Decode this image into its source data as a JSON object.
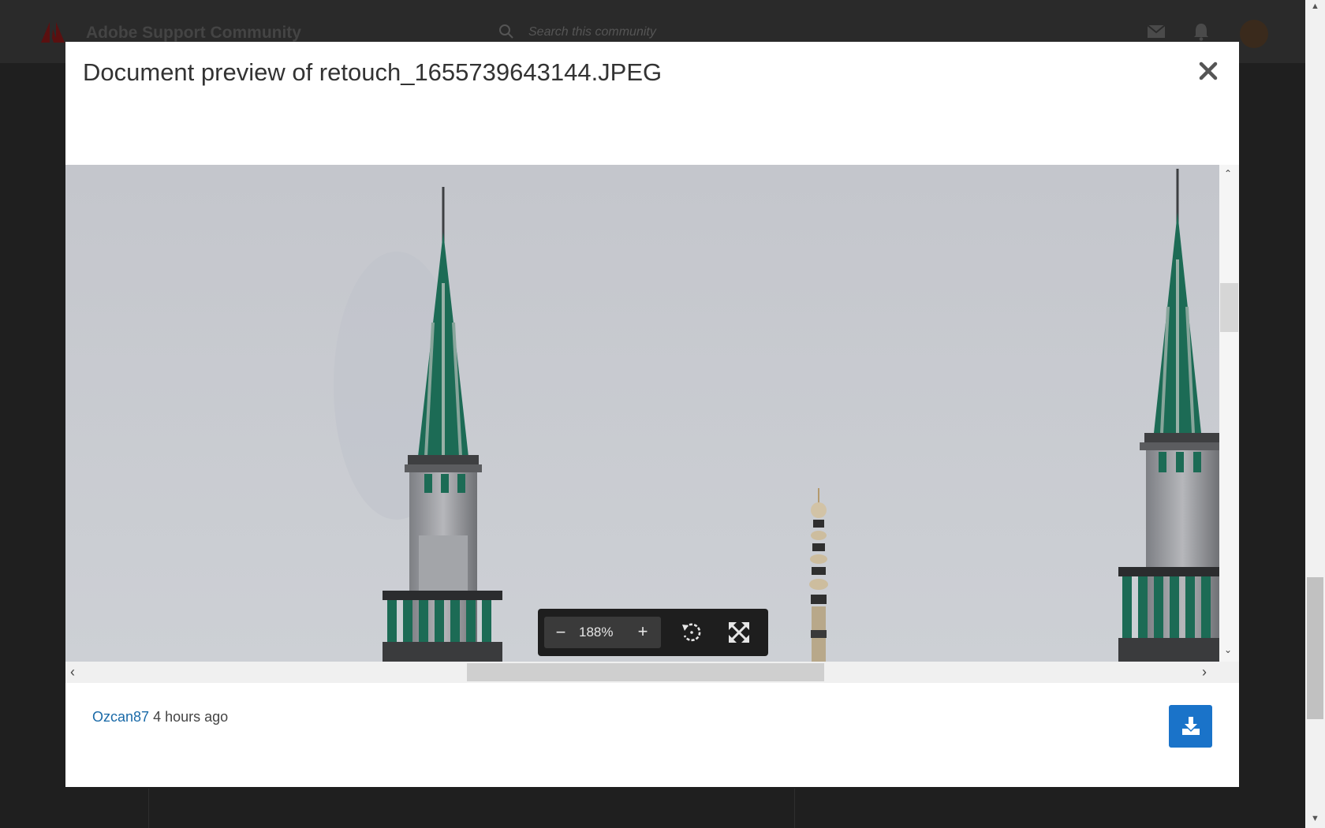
{
  "background": {
    "site_title": "Adobe Support Community",
    "search_placeholder": "Search this community"
  },
  "modal": {
    "title": "Document preview of retouch_1655739643144.JPEG",
    "close_icon": "close-icon",
    "image_alt": "Minarets against grey sky",
    "vertical_scroll_position": 0.3,
    "horizontal_scroll_position": 0.36,
    "toolbar": {
      "zoom_out_label": "−",
      "zoom_level": "188%",
      "zoom_in_label": "+",
      "rotate_icon": "rotate-icon",
      "fullscreen_icon": "fullscreen-icon"
    },
    "footer": {
      "author": "Ozcan87",
      "timestamp": "4 hours ago",
      "download_icon": "download-icon"
    }
  },
  "colors": {
    "accent": "#1a73c9",
    "link": "#1a6aa8",
    "sky": "#c7c9ce",
    "minaret_green": "#1c6b55"
  }
}
